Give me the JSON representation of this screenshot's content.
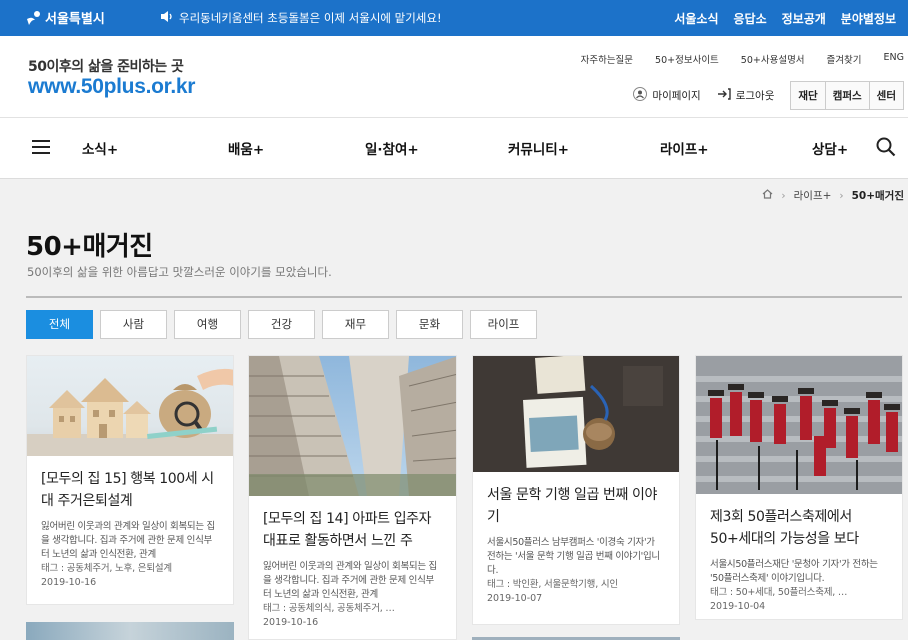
{
  "topbar": {
    "logo": "서울특별시",
    "notice": "우리동네키움센터 초등돌봄은 이제 서울시에 맡기세요!",
    "links": [
      "서울소식",
      "응답소",
      "정보공개",
      "분야별정보"
    ]
  },
  "header": {
    "tagline": "50이후의 삶을 준비하는 곳",
    "url": "www.50plus.or.kr",
    "util_links": [
      "자주하는질문",
      "50+정보사이트",
      "50+사용설명서",
      "즐겨찾기",
      "ENG"
    ],
    "mypage": "마이페이지",
    "logout": "로그아웃",
    "sections": [
      "재단",
      "캠퍼스",
      "센터"
    ]
  },
  "gnb": {
    "items": [
      "소식+",
      "배움+",
      "일·참여+",
      "커뮤니티+",
      "라이프+",
      "상담+"
    ]
  },
  "breadcrumb": [
    "라이프+",
    "50+매거진"
  ],
  "page": {
    "title": "50+매거진",
    "description": "50이후의 삶을 위한 아름답고 맛깔스러운 이야기를 모았습니다."
  },
  "categories": [
    "전체",
    "사람",
    "여행",
    "건강",
    "재무",
    "문화",
    "라이프"
  ],
  "active_category": "전체",
  "cards": [
    {
      "title": "[모두의 집 15] 행복 100세 시대 주거은퇴설계",
      "summary": "잃어버린 이웃과의 관계와 일상이 회복되는 집을 생각합니다. 집과 주거에 관한 문제 인식부터 노년의 삶과 인식전환, 관계",
      "tags": "태그 : 공동체주거, 노후, 은퇴설계",
      "date": "2019-10-16"
    },
    {
      "title": "[모두의 집 14] 아파트 입주자대표로 활동하면서 느낀 주",
      "summary": "잃어버린 이웃과의 관계와 일상이 회복되는 집을 생각합니다. 집과 주거에 관한 문제 인식부터 노년의 삶과 인식전환, 관계",
      "tags": "태그 : 공동체의식, 공동체주거, …",
      "date": "2019-10-16"
    },
    {
      "title": "서울 문학 기행 일곱 번째 이야기",
      "summary": "서울시50플러스 남부캠퍼스 '이경숙 기자'가 전하는 '서울 문학 기행 일곱 번째 이야기'입니다.",
      "tags": "태그 : 박인환, 서울문학기행, 시인",
      "date": "2019-10-07"
    },
    {
      "title": "제3회 50플러스축제에서 50+세대의 가능성을 보다",
      "summary": "서울시50플러스재단 '문청아 기자'가 전하는 '50플러스축제' 이야기입니다.",
      "tags": "태그 : 50+세대, 50플러스축제, …",
      "date": "2019-10-04"
    }
  ],
  "colors": {
    "seoul_blue": "#1c72c9",
    "brand_blue": "#1b7bd1",
    "active_tab": "#1b8ee0"
  }
}
